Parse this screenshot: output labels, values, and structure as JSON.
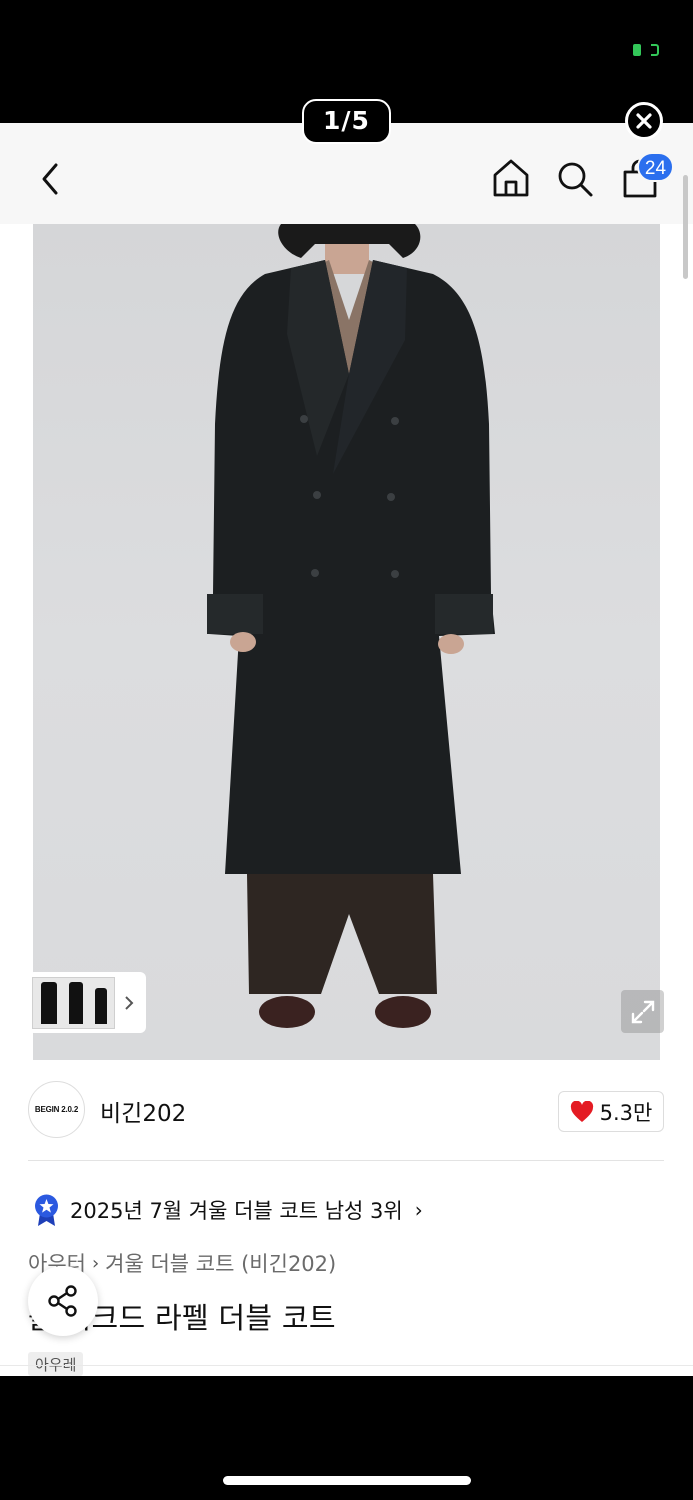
{
  "viewer": {
    "counter": "1/5"
  },
  "header": {
    "cart_count": "24"
  },
  "brand": {
    "logo_text": "BEGIN 2.0.2",
    "name": "비긴202",
    "likes": "5.3만"
  },
  "ranking": {
    "text": "2025년 7월 겨울 더블 코트 남성 3위"
  },
  "breadcrumb": {
    "category": "아우터",
    "subcategory": "겨울 더블 코트 (비긴202)"
  },
  "product": {
    "title": "블 피크드 라펠 더블 코트",
    "tag": "아우레"
  },
  "colors": {
    "accent": "#2b6fee",
    "heart": "#e41b23",
    "status_green": "#33c759"
  },
  "icons": [
    "back-icon",
    "home-icon",
    "search-icon",
    "shopping-bag-icon",
    "close-icon",
    "expand-icon",
    "heart-icon",
    "share-icon",
    "ranking-badge-icon",
    "chevron-right-icon"
  ]
}
